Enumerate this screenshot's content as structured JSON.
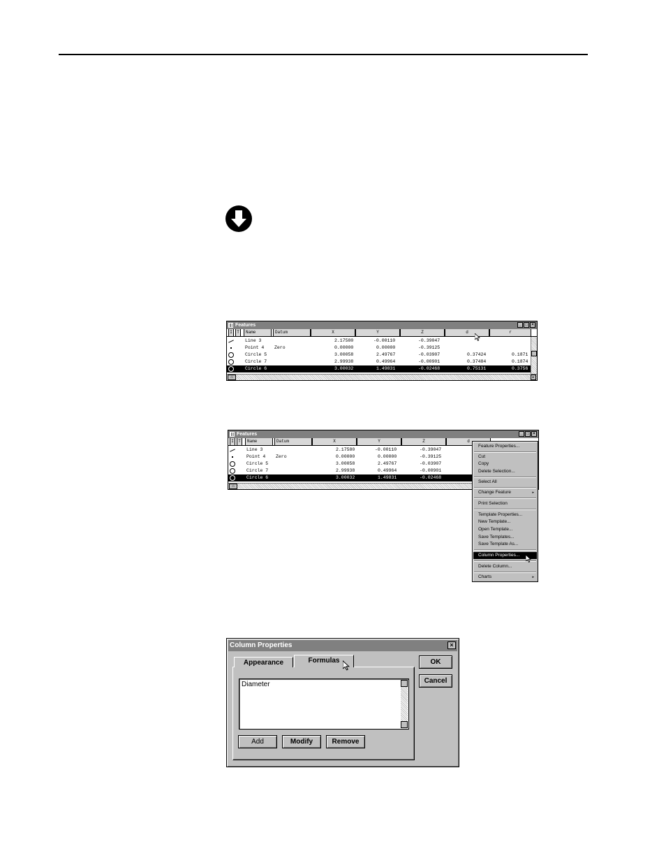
{
  "window": {
    "title": "Features",
    "columns": [
      "I",
      "T",
      "Name",
      "Datum",
      "X",
      "Y",
      "Z",
      "d",
      "r"
    ],
    "columns_b": [
      "I",
      "T",
      "Name",
      "Datum",
      "X",
      "Y",
      "Z",
      "d"
    ],
    "rows": [
      {
        "icon": "line",
        "name": "Line 3",
        "datum": "",
        "x": "2.17580",
        "y": "-0.00110",
        "z": "-0.39047",
        "d": "",
        "r": ""
      },
      {
        "icon": "point",
        "name": "Point 4",
        "datum": "Zero",
        "x": "0.00000",
        "y": "0.00000",
        "z": "-0.39125",
        "d": "",
        "r": ""
      },
      {
        "icon": "circle",
        "name": "Circle 5",
        "datum": "",
        "x": "3.00058",
        "y": "2.49767",
        "z": "-0.03907",
        "d": "0.37424",
        "r": "0.1871"
      },
      {
        "icon": "circle",
        "name": "Circle 7",
        "datum": "",
        "x": "2.99938",
        "y": "0.49964",
        "z": "-0.00901",
        "d": "0.37484",
        "r": "0.1874"
      },
      {
        "icon": "circle",
        "name": "Circle 6",
        "datum": "",
        "x": "3.00032",
        "y": "1.49831",
        "z": "-0.02468",
        "d": "0.75131",
        "r": "0.3756",
        "selected": true
      }
    ]
  },
  "context_menu": {
    "items": [
      {
        "label": "Feature Properties..."
      },
      {
        "label": "Cut"
      },
      {
        "label": "Copy"
      },
      {
        "label": "Delete Selection..."
      },
      {
        "label": "Select All"
      },
      {
        "label": "Change Feature",
        "submenu": true
      },
      {
        "label": "Print Selection"
      },
      {
        "label": "Template Properties..."
      },
      {
        "label": "New Template..."
      },
      {
        "label": "Open Template..."
      },
      {
        "label": "Save Templates..."
      },
      {
        "label": "Save Template As..."
      },
      {
        "label": "Column Properties...",
        "highlighted": true
      },
      {
        "label": "Delete Column..."
      },
      {
        "label": "Charts",
        "submenu": true
      }
    ]
  },
  "dialog": {
    "title": "Column Properties",
    "tabs": [
      "Appearance",
      "Formulas"
    ],
    "active_tab": "Formulas",
    "formulas": [
      "Diameter"
    ],
    "add_label": "Add",
    "modify_label": "Modify",
    "remove_label": "Remove",
    "ok_label": "OK",
    "cancel_label": "Cancel",
    "close_glyph": "×"
  },
  "icons": {
    "note_icon": "down-arrow-circle-icon",
    "minimize": "_",
    "maximize": "□",
    "close": "×",
    "home": "⌂",
    "submenu_arrow": "▸"
  }
}
